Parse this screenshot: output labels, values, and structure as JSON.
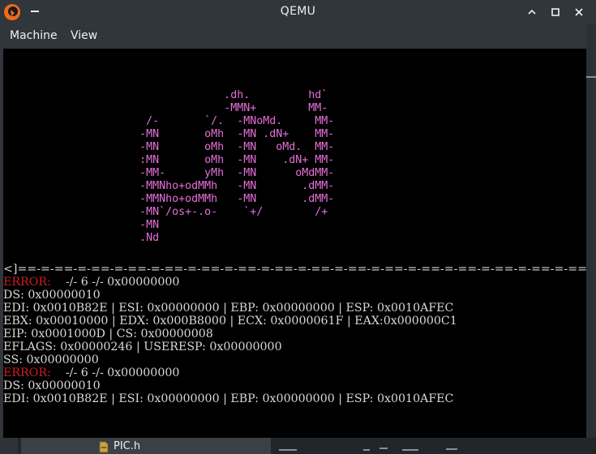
{
  "window": {
    "title": "QEMU"
  },
  "menu": {
    "items": [
      {
        "label": "Machine"
      },
      {
        "label": "View"
      }
    ]
  },
  "screen": {
    "logo_lines": [
      "                                  .dh.         hd`",
      "                                  -MMN+        MM-",
      "                      /-       `/.  -MNoMd.     MM-",
      "                     -MN       oMh  -MN .dN+    MM-",
      "                     -MN       oMh  -MN   oMd.  MM-",
      "                     :MN       oMh  -MN    .dN+ MM-",
      "                     -MM-      yMh  -MN      oMdMM-",
      "                     -MMNho+odMMh   -MN       .dMM-",
      "                     -MMNho+odMMh   -MN       .dMM-",
      "                     -MN`/os+-.o-    `+/        /+",
      "                     -MN",
      "                     .Nd"
    ],
    "console_lines": [
      {
        "prefix": "<]",
        "text": "==-=-==-=-==-=-==-=-==-=-==-=-==-=-==-=-==-=-==-=-==-=-==-=-==-=-==-=-==-=-==-=-==-=-==>"
      },
      {
        "prefix": "ERROR:",
        "text": "    -/- 6 -/- 0x00000000"
      },
      {
        "prefix": "",
        "text": "DS: 0x00000010"
      },
      {
        "prefix": "",
        "text": "EDI: 0x0010B82E | ESI: 0x00000000 | EBP: 0x00000000 | ESP: 0x0010AFEC"
      },
      {
        "prefix": "",
        "text": "EBX: 0x00010000 | EDX: 0x000B8000 | ECX: 0x0000061F | EAX:0x000000C1"
      },
      {
        "prefix": "",
        "text": "EIP: 0x0001000D | CS: 0x00000008"
      },
      {
        "prefix": "",
        "text": "EFLAGS: 0x00000246 | USERESP: 0x00000000"
      },
      {
        "prefix": "",
        "text": "SS: 0x00000000"
      },
      {
        "prefix": "ERROR:",
        "text": "    -/- 6 -/- 0x00000000"
      },
      {
        "prefix": "",
        "text": "DS: 0x00000010"
      },
      {
        "prefix": "",
        "text": "EDI: 0x0010B82E | ESI: 0x00000000 | EBP: 0x00000000 | ESP: 0x0010AFEC"
      }
    ]
  },
  "taskbar": {
    "file_label": "PIC.h"
  },
  "colors": {
    "logo": "#e66fd9",
    "error": "#cc1f1f",
    "console_text": "#d8d8d8",
    "chrome": "#31363b"
  },
  "icons": [
    "qemu-app-icon",
    "minimize-icon",
    "chevron-up-icon",
    "maximize-icon",
    "close-icon",
    "header-file-icon"
  ]
}
